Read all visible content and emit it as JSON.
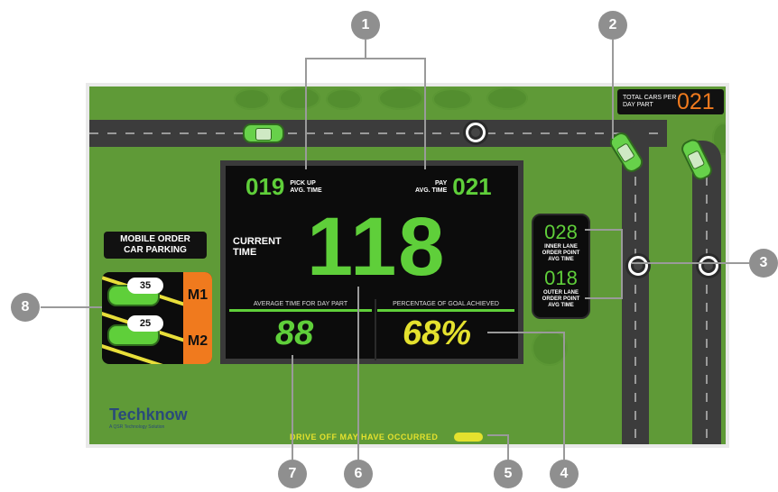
{
  "callouts": [
    "1",
    "2",
    "3",
    "4",
    "5",
    "6",
    "7",
    "8"
  ],
  "total_cars": {
    "label": "TOTAL CARS PER DAY PART",
    "value": "021"
  },
  "pickup": {
    "value": "019",
    "label_line1": "PICK UP",
    "label_line2": "AVG. TIME"
  },
  "pay": {
    "value": "021",
    "label_line1": "PAY",
    "label_line2": "AVG. TIME"
  },
  "current_time": {
    "label_line1": "CURRENT",
    "label_line2": "TIME",
    "value": "118"
  },
  "average": {
    "label": "AVERAGE TIME FOR DAY PART",
    "value": "88"
  },
  "goal": {
    "label": "PERCENTAGE OF GOAL ACHIEVED",
    "value": "68%"
  },
  "inner_lane": {
    "value": "028",
    "label_line1": "INNER LANE",
    "label_line2": "ORDER POINT",
    "label_line3": "AVG TIME"
  },
  "outer_lane": {
    "value": "018",
    "label_line1": "OUTER LANE",
    "label_line2": "ORDER POINT",
    "label_line3": "AVG TIME"
  },
  "mobile_order": {
    "label_line1": "MOBILE ORDER",
    "label_line2": "CAR PARKING",
    "spots": [
      {
        "number": "35",
        "label": "M1"
      },
      {
        "number": "25",
        "label": "M2"
      }
    ]
  },
  "logo": {
    "text": "Techknow",
    "tagline": "A QSR Technology Solution"
  },
  "drive_off": "DRIVE OFF MAY HAVE OCCURRED",
  "colors": {
    "green": "#5fcf3a",
    "yellow": "#e4e12e",
    "orange": "#f07a1e",
    "grass": "#5f9a37",
    "panel": "#0c0c0c"
  }
}
